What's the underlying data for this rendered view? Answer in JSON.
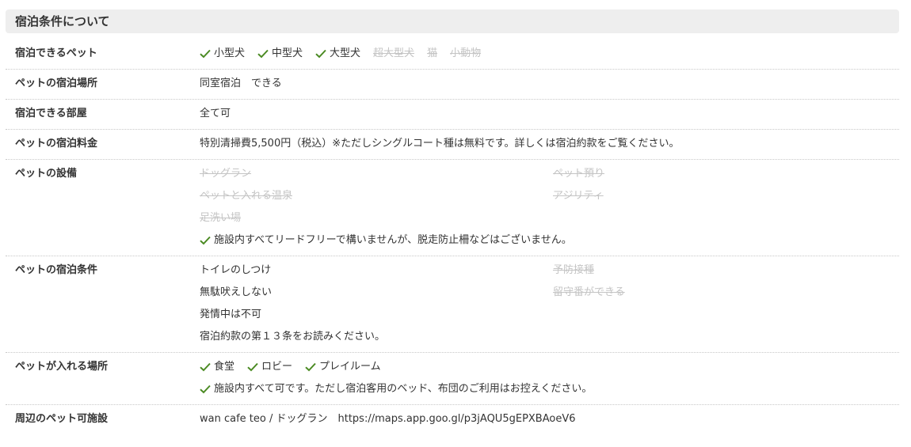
{
  "header": {
    "title": "宿泊条件について"
  },
  "pets": {
    "label": "宿泊できるペット",
    "tags": [
      {
        "text": "小型犬",
        "enabled": true
      },
      {
        "text": "中型犬",
        "enabled": true
      },
      {
        "text": "大型犬",
        "enabled": true
      },
      {
        "text": "超大型犬",
        "enabled": false
      },
      {
        "text": "猫",
        "enabled": false
      },
      {
        "text": "小動物",
        "enabled": false
      }
    ]
  },
  "place": {
    "label": "ペットの宿泊場所",
    "value": "同室宿泊　できる"
  },
  "rooms": {
    "label": "宿泊できる部屋",
    "value": "全て可"
  },
  "fee": {
    "label": "ペットの宿泊料金",
    "value": "特別清掃費5,500円（税込）※ただしシングルコート種は無料です。詳しくは宿泊約款をご覧ください。"
  },
  "facilities": {
    "label": "ペットの設備",
    "items": [
      "ドッグラン",
      "ペット預り",
      "ペットと入れる温泉",
      "アジリティ",
      "足洗い場"
    ],
    "note": "施設内すべてリードフリーで構いませんが、脱走防止柵などはございません。"
  },
  "conditions": {
    "label": "ペットの宿泊条件",
    "items": [
      {
        "text": "トイレのしつけ",
        "enabled": true
      },
      {
        "text": "予防接種",
        "enabled": false
      },
      {
        "text": "無駄吠えしない",
        "enabled": true
      },
      {
        "text": "留守番ができる",
        "enabled": false
      },
      {
        "text": "発情中は不可",
        "enabled": true
      }
    ],
    "note": "宿泊約款の第１３条をお読みください。"
  },
  "areas": {
    "label": "ペットが入れる場所",
    "tags": [
      "食堂",
      "ロビー",
      "プレイルーム"
    ],
    "note": "施設内すべて可です。ただし宿泊客用のベッド、布団のご利用はお控えください。"
  },
  "nearby": {
    "label": "周辺のペット可施設",
    "value": "wan cafe teo / ドッグラン　https://maps.app.goo.gl/p3jAQU5gEPXBAoeV6"
  },
  "colors": {
    "check": "#4a8a22",
    "disabled": "#c4c4c4",
    "header_bg": "#eeeeee"
  }
}
